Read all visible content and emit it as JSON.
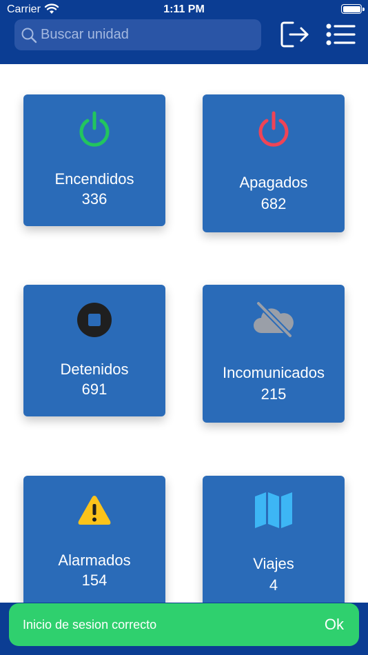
{
  "status_bar": {
    "carrier": "Carrier",
    "time": "1:11 PM"
  },
  "search": {
    "placeholder": "Buscar unidad",
    "value": ""
  },
  "header": {
    "logout_icon": "logout-icon",
    "menu_icon": "list-menu-icon"
  },
  "cards": [
    {
      "label": "Encendidos",
      "count": "336",
      "icon": "power-icon",
      "icon_color": "#22c55e"
    },
    {
      "label": "Apagados",
      "count": "682",
      "icon": "power-icon",
      "icon_color": "#ef4456"
    },
    {
      "label": "Detenidos",
      "count": "691",
      "icon": "stop-icon",
      "icon_color": "#1f1f1f"
    },
    {
      "label": "Incomunicados",
      "count": "215",
      "icon": "cloud-slash-icon",
      "icon_color": "#9a9fa8"
    },
    {
      "label": "Alarmados",
      "count": "154",
      "icon": "warning-icon",
      "icon_color": "#fbc31b"
    },
    {
      "label": "Viajes",
      "count": "4",
      "icon": "map-icon",
      "icon_color": "#3db6f5"
    }
  ],
  "toast": {
    "message": "Inicio de sesion correcto",
    "action": "Ok"
  },
  "colors": {
    "header_bg": "#0b3d93",
    "card_bg": "#2a6bb8",
    "toast_bg": "#2fd06e"
  }
}
